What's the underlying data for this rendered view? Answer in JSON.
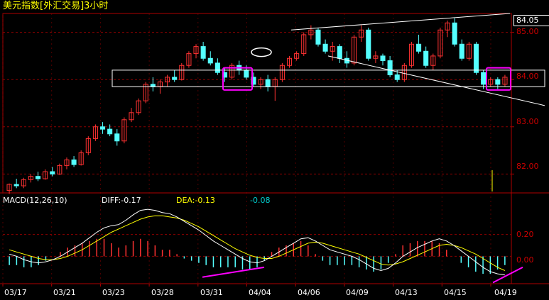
{
  "header": {
    "title": "美元指数[外汇交易]3小时"
  },
  "price_panel": {
    "last_price_tag": "84.05",
    "y_ticks": [
      "85.00",
      "84.00",
      "83.00",
      "82.00"
    ]
  },
  "macd_panel": {
    "label": "MACD(12,26,10)",
    "diff": "DIFF:-0.17",
    "dea": "DEA:-0.13",
    "macd": "-0.08",
    "y_ticks": [
      "0.20",
      "0.00"
    ]
  },
  "x_axis": {
    "dates": [
      "03/17",
      "03/21",
      "03/23",
      "03/28",
      "03/31",
      "04/04",
      "04/06",
      "04/09",
      "04/13",
      "04/15",
      "04/19"
    ]
  },
  "colors": {
    "background": "#000000",
    "up_candle": "#ff3232",
    "down_candle": "#54ffff",
    "grid": "#8b0000",
    "title": "#ffff00",
    "diff_line": "#ffffff",
    "dea_line": "#ffff00",
    "annotation_box": "#ff00ff",
    "trend_lines": "#ffffff"
  },
  "chart_data": [
    {
      "type": "candlestick",
      "title": "美元指数[外汇交易]3小时",
      "ylim": [
        81.6,
        85.4
      ],
      "y_ticks": [
        85.0,
        84.0,
        83.0,
        82.0
      ],
      "last_price": 84.05,
      "x_labels": [
        "03/17",
        "03/21",
        "03/23",
        "03/28",
        "03/31",
        "04/04",
        "04/06",
        "04/09",
        "04/13",
        "04/15",
        "04/19"
      ],
      "candles": [
        [
          81.65,
          81.8,
          81.58,
          81.78
        ],
        [
          81.78,
          81.9,
          81.7,
          81.75
        ],
        [
          81.75,
          81.92,
          81.7,
          81.88
        ],
        [
          81.88,
          82.0,
          81.82,
          81.95
        ],
        [
          81.95,
          82.05,
          81.85,
          81.9
        ],
        [
          81.9,
          82.1,
          81.88,
          82.05
        ],
        [
          82.05,
          82.15,
          81.95,
          82.0
        ],
        [
          82.0,
          82.22,
          81.98,
          82.18
        ],
        [
          82.18,
          82.35,
          82.1,
          82.3
        ],
        [
          82.3,
          82.38,
          82.15,
          82.2
        ],
        [
          82.2,
          82.5,
          82.18,
          82.45
        ],
        [
          82.45,
          82.8,
          82.4,
          82.75
        ],
        [
          82.75,
          83.05,
          82.7,
          83.0
        ],
        [
          83.0,
          83.1,
          82.85,
          82.95
        ],
        [
          82.95,
          83.05,
          82.8,
          82.85
        ],
        [
          82.85,
          82.95,
          82.6,
          82.7
        ],
        [
          82.7,
          83.2,
          82.65,
          83.15
        ],
        [
          83.15,
          83.4,
          83.1,
          83.3
        ],
        [
          83.3,
          83.6,
          83.25,
          83.55
        ],
        [
          83.55,
          83.95,
          83.5,
          83.9
        ],
        [
          83.9,
          84.05,
          83.75,
          83.85
        ],
        [
          83.85,
          84.0,
          83.7,
          83.95
        ],
        [
          83.95,
          84.1,
          83.85,
          84.05
        ],
        [
          84.05,
          84.2,
          83.95,
          84.0
        ],
        [
          84.0,
          84.35,
          83.98,
          84.3
        ],
        [
          84.3,
          84.6,
          84.25,
          84.55
        ],
        [
          84.55,
          84.75,
          84.45,
          84.7
        ],
        [
          84.7,
          84.8,
          84.4,
          84.45
        ],
        [
          84.45,
          84.6,
          84.3,
          84.35
        ],
        [
          84.35,
          84.45,
          84.1,
          84.15
        ],
        [
          84.15,
          84.25,
          83.95,
          84.05
        ],
        [
          84.05,
          84.35,
          84.0,
          84.3
        ],
        [
          84.3,
          84.4,
          84.1,
          84.2
        ],
        [
          84.2,
          84.3,
          84.0,
          84.05
        ],
        [
          84.05,
          84.15,
          83.85,
          83.9
        ],
        [
          83.9,
          84.05,
          83.8,
          84.0
        ],
        [
          84.0,
          84.1,
          83.75,
          83.85
        ],
        [
          83.85,
          84.05,
          83.55,
          84.0
        ],
        [
          84.0,
          84.35,
          83.95,
          84.3
        ],
        [
          84.3,
          84.5,
          84.25,
          84.45
        ],
        [
          84.45,
          84.6,
          84.4,
          84.55
        ],
        [
          84.55,
          85.0,
          84.5,
          84.95
        ],
        [
          84.95,
          85.15,
          84.85,
          85.05
        ],
        [
          85.05,
          85.1,
          84.7,
          84.75
        ],
        [
          84.75,
          84.85,
          84.55,
          84.6
        ],
        [
          84.6,
          84.8,
          84.4,
          84.7
        ],
        [
          84.7,
          84.75,
          84.35,
          84.45
        ],
        [
          84.45,
          84.6,
          84.25,
          84.35
        ],
        [
          84.35,
          84.95,
          84.3,
          84.9
        ],
        [
          84.9,
          85.15,
          84.8,
          85.05
        ],
        [
          85.05,
          85.1,
          84.4,
          84.45
        ],
        [
          84.45,
          84.6,
          84.35,
          84.5
        ],
        [
          84.5,
          84.55,
          84.3,
          84.4
        ],
        [
          84.4,
          84.5,
          84.05,
          84.1
        ],
        [
          84.1,
          84.2,
          83.95,
          84.0
        ],
        [
          84.0,
          84.35,
          83.95,
          84.3
        ],
        [
          84.3,
          84.8,
          84.25,
          84.75
        ],
        [
          84.75,
          84.95,
          84.55,
          84.6
        ],
        [
          84.6,
          84.7,
          84.25,
          84.3
        ],
        [
          84.3,
          84.55,
          84.2,
          84.5
        ],
        [
          84.5,
          85.1,
          84.45,
          85.05
        ],
        [
          85.05,
          85.25,
          84.9,
          85.2
        ],
        [
          85.2,
          85.3,
          84.7,
          84.75
        ],
        [
          84.75,
          84.85,
          84.4,
          84.45
        ],
        [
          84.45,
          84.8,
          84.4,
          84.75
        ],
        [
          84.75,
          84.8,
          84.1,
          84.15
        ],
        [
          84.15,
          84.2,
          83.8,
          83.9
        ],
        [
          83.9,
          84.05,
          83.85,
          84.0
        ],
        [
          84.0,
          84.05,
          83.8,
          83.9
        ],
        [
          83.9,
          84.1,
          83.85,
          84.05
        ]
      ]
    },
    {
      "type": "macd",
      "title": "MACD(12,26,10)",
      "series": [
        {
          "name": "DIFF",
          "last": -0.17
        },
        {
          "name": "DEA",
          "last": -0.13
        },
        {
          "name": "MACD",
          "last": -0.08
        }
      ],
      "ylim": [
        -0.25,
        0.45
      ],
      "y_ticks": [
        0.2,
        0.0
      ],
      "diff": [
        0.02,
        0.0,
        -0.03,
        -0.05,
        -0.06,
        -0.05,
        -0.03,
        0.0,
        0.04,
        0.08,
        0.12,
        0.17,
        0.22,
        0.26,
        0.28,
        0.29,
        0.33,
        0.38,
        0.42,
        0.43,
        0.42,
        0.4,
        0.39,
        0.36,
        0.32,
        0.28,
        0.24,
        0.19,
        0.14,
        0.1,
        0.06,
        0.02,
        -0.02,
        -0.05,
        -0.06,
        -0.04,
        0.0,
        0.04,
        0.08,
        0.12,
        0.16,
        0.17,
        0.14,
        0.1,
        0.06,
        0.04,
        0.02,
        0.0,
        -0.03,
        -0.07,
        -0.11,
        -0.13,
        -0.11,
        -0.06,
        0.0,
        0.04,
        0.08,
        0.11,
        0.14,
        0.16,
        0.14,
        0.1,
        0.05,
        0.0,
        -0.05,
        -0.1,
        -0.14,
        -0.16,
        -0.17
      ],
      "dea": [
        0.06,
        0.04,
        0.02,
        0.0,
        -0.02,
        -0.03,
        -0.03,
        -0.02,
        0.0,
        0.03,
        0.06,
        0.1,
        0.14,
        0.18,
        0.22,
        0.25,
        0.28,
        0.31,
        0.34,
        0.36,
        0.37,
        0.37,
        0.36,
        0.35,
        0.33,
        0.3,
        0.27,
        0.23,
        0.19,
        0.15,
        0.11,
        0.07,
        0.04,
        0.01,
        -0.01,
        -0.02,
        -0.02,
        0.0,
        0.03,
        0.06,
        0.09,
        0.12,
        0.13,
        0.12,
        0.1,
        0.08,
        0.06,
        0.04,
        0.02,
        -0.01,
        -0.04,
        -0.07,
        -0.08,
        -0.07,
        -0.05,
        -0.02,
        0.01,
        0.04,
        0.07,
        0.1,
        0.11,
        0.1,
        0.08,
        0.05,
        0.02,
        -0.02,
        -0.06,
        -0.1,
        -0.13
      ],
      "histogram": [
        -0.08,
        -0.08,
        -0.1,
        -0.1,
        -0.08,
        -0.04,
        0.0,
        0.04,
        0.08,
        0.1,
        0.12,
        0.14,
        0.16,
        0.16,
        0.12,
        0.08,
        0.1,
        0.14,
        0.16,
        0.14,
        0.1,
        0.06,
        0.06,
        0.02,
        -0.02,
        -0.04,
        -0.06,
        -0.08,
        -0.1,
        -0.1,
        -0.1,
        -0.1,
        -0.12,
        -0.12,
        -0.1,
        -0.04,
        0.04,
        0.08,
        0.1,
        0.12,
        0.14,
        0.1,
        0.02,
        -0.04,
        -0.08,
        -0.08,
        -0.08,
        -0.08,
        -0.1,
        -0.12,
        -0.14,
        -0.12,
        -0.06,
        0.02,
        0.1,
        0.12,
        0.14,
        0.14,
        0.14,
        0.12,
        0.06,
        0.0,
        -0.06,
        -0.1,
        -0.14,
        -0.16,
        -0.16,
        -0.12,
        -0.08
      ]
    }
  ]
}
